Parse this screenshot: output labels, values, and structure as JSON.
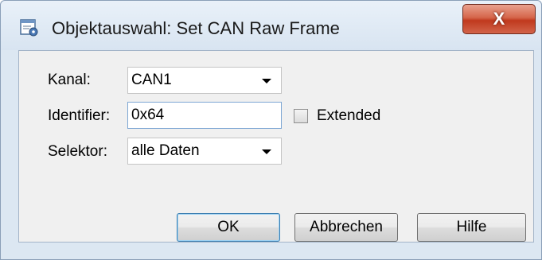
{
  "window": {
    "title": "Objektauswahl: Set CAN Raw Frame",
    "close_label": "X"
  },
  "form": {
    "kanal_label": "Kanal:",
    "kanal_value": "CAN1",
    "identifier_label": "Identifier:",
    "identifier_value": "0x64",
    "extended_label": "Extended",
    "extended_checked": false,
    "selektor_label": "Selektor:",
    "selektor_value": "alle Daten"
  },
  "buttons": {
    "ok": "OK",
    "cancel": "Abbrechen",
    "help": "Hilfe"
  },
  "icons": {
    "app": "dialog-settings-icon",
    "dropdown": "chevron-down-icon"
  }
}
